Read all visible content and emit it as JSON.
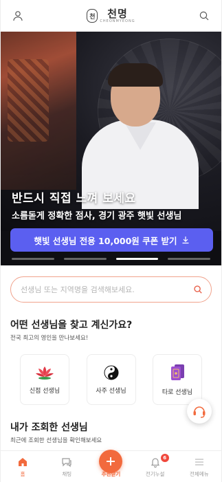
{
  "header": {
    "logo_text": "천명",
    "logo_sub": "CHEONMYEONG",
    "logo_mark": "천"
  },
  "hero": {
    "title": "반드시 직접 느껴 보세요",
    "subtitle": "소름돋게 정확한 점사, 경기 광주 햇빛 선생님",
    "coupon_label": "햇빛 선생님 전용 10,000원 쿠폰 받기",
    "slide_count": 4,
    "active_slide": 3
  },
  "search": {
    "placeholder": "선생님 또는 지역명을 검색해보세요."
  },
  "find_section": {
    "title": "어떤 선생님을 찾고 계신가요?",
    "subtitle": "전국 최고의 영인을 만나보세요!",
    "categories": [
      {
        "label": "신점 선생님",
        "icon": "lotus-icon"
      },
      {
        "label": "사주 선생님",
        "icon": "yin-yang-icon"
      },
      {
        "label": "타로 선생님",
        "icon": "tarot-cards-icon"
      }
    ]
  },
  "recent_section": {
    "title": "내가 조회한 선생님",
    "subtitle": "최근에 조회한 선생님을 확인해보세요"
  },
  "tabbar": {
    "items": [
      {
        "label": "홈",
        "icon": "home-icon"
      },
      {
        "label": "채팅",
        "icon": "chat-icon"
      },
      {
        "label": "추천받기",
        "icon": "plus-icon"
      },
      {
        "label": "전기누설",
        "icon": "bell-icon",
        "badge": "6"
      },
      {
        "label": "전체메뉴",
        "icon": "menu-icon"
      }
    ]
  },
  "colors": {
    "accent": "#f26a3d",
    "coupon": "#5b5ff0",
    "search_border": "#f0a28c"
  }
}
